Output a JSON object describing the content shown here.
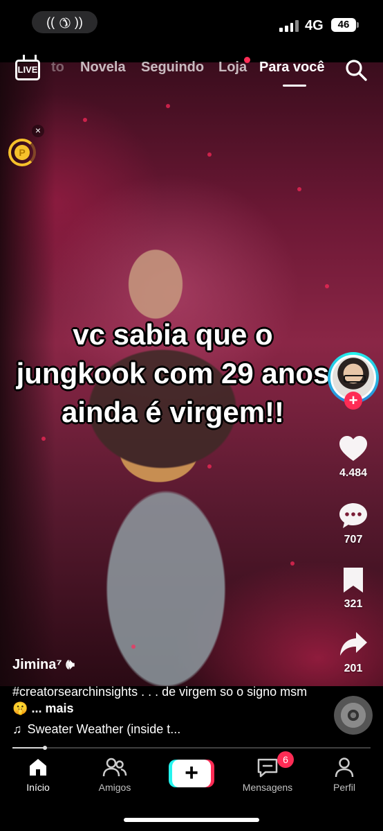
{
  "status_bar": {
    "network": "4G",
    "battery": "46",
    "call_icon": "phone-icon"
  },
  "top_nav": {
    "live_label": "LIVE",
    "tabs": [
      {
        "label": "to",
        "state": "faded"
      },
      {
        "label": "Novela",
        "state": "normal"
      },
      {
        "label": "Seguindo",
        "state": "normal"
      },
      {
        "label": "Loja",
        "state": "normal"
      },
      {
        "label": "Para você",
        "state": "active"
      }
    ],
    "search_icon": "search-icon"
  },
  "coin_widget": {
    "label": "P",
    "close": "×"
  },
  "video": {
    "caption": "vc sabia que o\njungkook com 29 anos\nainda é  virgem!!"
  },
  "right_rail": {
    "follow_label": "+",
    "likes": "4.484",
    "comments": "707",
    "saves": "321",
    "shares": "201"
  },
  "post": {
    "author": "Jimina⁷",
    "description": "#creatorsearchinsights  . . . de virgem so o signo msm🤫",
    "more_label": "... mais",
    "music": "Sweater Weather (inside t..."
  },
  "playback": {
    "progress": 0.09
  },
  "bottom_nav": {
    "items": [
      {
        "label": "Início",
        "icon": "home-icon",
        "active": true
      },
      {
        "label": "Amigos",
        "icon": "friends-icon",
        "active": false
      },
      {
        "label": "Mensagens",
        "icon": "messages-icon",
        "active": false
      },
      {
        "label": "Perfil",
        "icon": "profile-icon",
        "active": false
      }
    ],
    "create_label": "+",
    "messages_badge": "6"
  },
  "colors": {
    "accent_red": "#fe2c55",
    "accent_cyan": "#25f4ee",
    "coin": "#f6c12b"
  }
}
